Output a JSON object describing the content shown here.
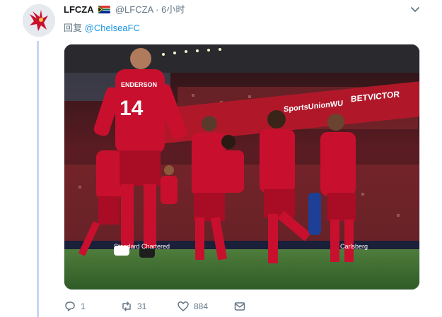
{
  "tweet": {
    "display_name": "LFCZA",
    "handle": "@LFCZA",
    "separator": "·",
    "time": "6小时",
    "reply_prefix": "回复",
    "reply_to": "@ChelseaFC"
  },
  "media": {
    "jersey_number": "14",
    "jersey_name": "ENDERSON",
    "ad_boards": [
      "SportsUnionWU",
      "BETVICTOR",
      "Standard Chartered",
      "Carlsberg"
    ],
    "description": "Liverpool players celebrating a goal at Anfield"
  },
  "actions": {
    "reply_count": "1",
    "retweet_count": "31",
    "like_count": "884"
  },
  "colors": {
    "accent": "#1b95e0",
    "muted": "#657786",
    "thread_line": "#c8d6f2",
    "kit_red": "#c8102e"
  }
}
